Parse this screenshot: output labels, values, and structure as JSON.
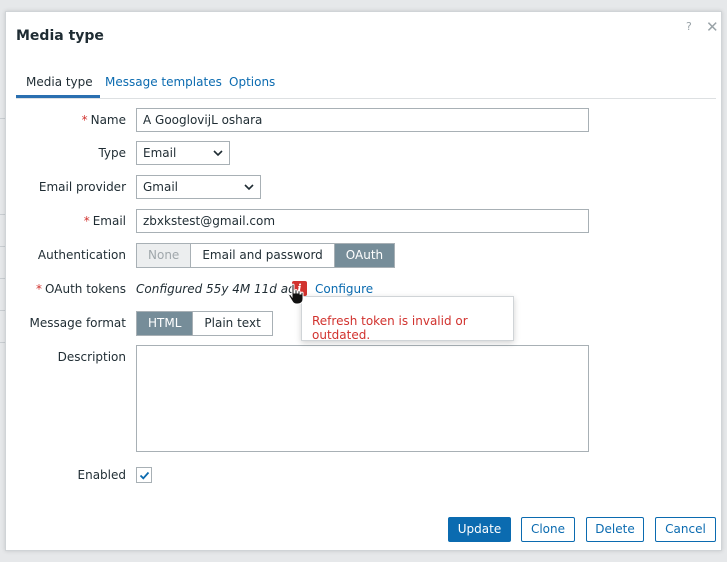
{
  "dialog": {
    "title": "Media type",
    "help_glyph": "?",
    "close_glyph": "✕"
  },
  "tabs": [
    {
      "label": "Media type",
      "active": true
    },
    {
      "label": "Message templates",
      "active": false
    },
    {
      "label": "Options",
      "active": false
    }
  ],
  "form": {
    "name": {
      "label": "Name",
      "value": "A GooglovijL oshara",
      "required": true
    },
    "type": {
      "label": "Type",
      "value": "Email"
    },
    "email_provider": {
      "label": "Email provider",
      "value": "Gmail"
    },
    "email": {
      "label": "Email",
      "value": "zbxkstest@gmail.com",
      "required": true
    },
    "authentication": {
      "label": "Authentication",
      "options": [
        "None",
        "Email and password",
        "OAuth"
      ],
      "selected": "OAuth"
    },
    "oauth_tokens": {
      "label": "OAuth tokens",
      "status": "Configured 55y 4M 11d ago",
      "info_glyph": "i",
      "configure_label": "Configure",
      "required": true
    },
    "message_format": {
      "label": "Message format",
      "options": [
        "HTML",
        "Plain text"
      ],
      "selected": "HTML"
    },
    "description": {
      "label": "Description",
      "value": ""
    },
    "enabled": {
      "label": "Enabled",
      "checked": true
    }
  },
  "tooltip": {
    "text": "Refresh token is invalid or outdated."
  },
  "buttons": {
    "update": "Update",
    "clone": "Clone",
    "delete": "Delete",
    "cancel": "Cancel"
  },
  "colors": {
    "accent": "#0b6bb0",
    "error": "#d1322e",
    "segment_selected": "#768d99"
  },
  "required_marker": "*"
}
